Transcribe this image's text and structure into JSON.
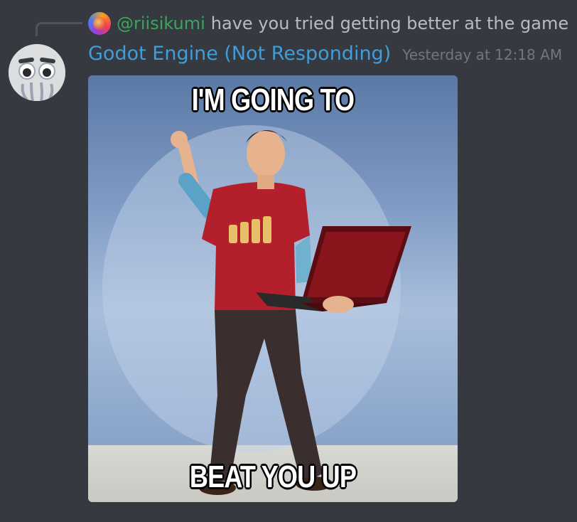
{
  "reply": {
    "username": "@riisikumi",
    "content": "have you tried getting better at the game"
  },
  "author": {
    "name": "Godot Engine (Not Responding)",
    "timestamp": "Yesterday at 12:18 AM"
  },
  "attachment": {
    "caption_top": "I'M GOING TO",
    "caption_bottom": "BEAT YOU UP"
  },
  "colors": {
    "background": "#36393f",
    "username": "#3e9edb",
    "reply_username": "#3ba55d",
    "reply_text": "#b9bbbe",
    "timestamp": "#72767d"
  }
}
